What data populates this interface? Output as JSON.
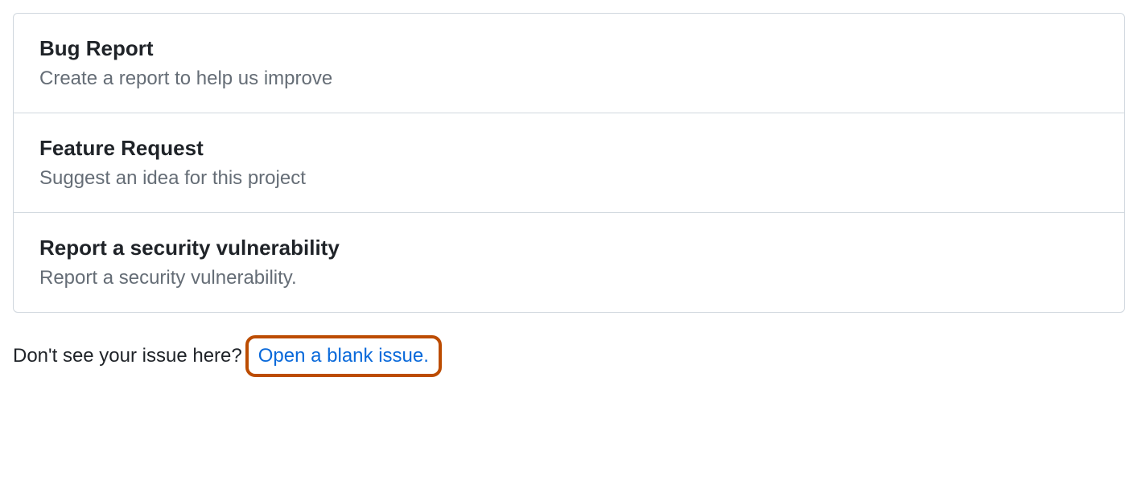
{
  "templates": [
    {
      "title": "Bug Report",
      "description": "Create a report to help us improve"
    },
    {
      "title": "Feature Request",
      "description": "Suggest an idea for this project"
    },
    {
      "title": "Report a security vulnerability",
      "description": "Report a security vulnerability."
    }
  ],
  "footer": {
    "text": "Don't see your issue here?",
    "link": "Open a blank issue."
  }
}
